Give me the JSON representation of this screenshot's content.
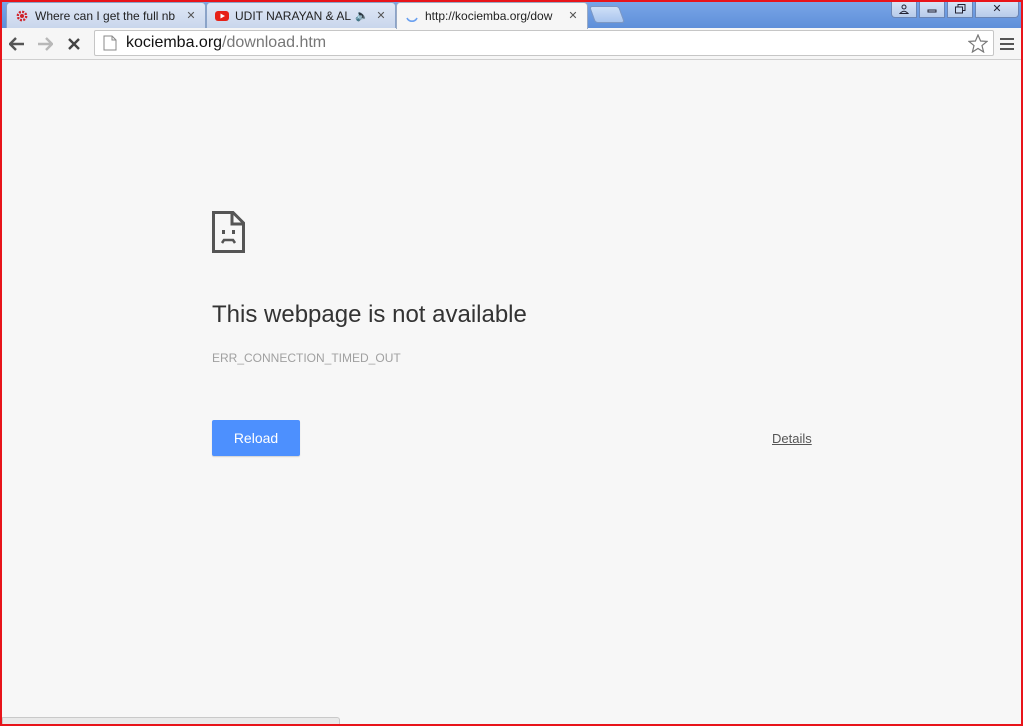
{
  "tabs": [
    {
      "title": "Where can I get the full nb",
      "favicon": "gear-icon",
      "favicon_color": "#d0222a"
    },
    {
      "title": "UDIT NARAYAN & ALK",
      "favicon": "youtube-icon",
      "favicon_color": "#e62117",
      "audio": "speaker-icon"
    },
    {
      "title": "http://kociemba.org/dow",
      "favicon": "loading-spinner-icon",
      "active": true
    }
  ],
  "omnibox": {
    "domain": "kociemba.org",
    "path": "/download.htm"
  },
  "error": {
    "title": "This webpage is not available",
    "code": "ERR_CONNECTION_TIMED_OUT",
    "reload_label": "Reload",
    "details_label": "Details"
  },
  "colors": {
    "reload_button": "#4d90fe",
    "frame_border": "#e8141a"
  }
}
